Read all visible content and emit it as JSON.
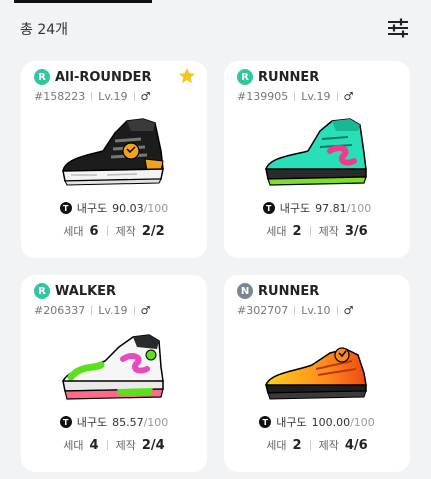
{
  "header": {
    "total_label": "총 24개"
  },
  "labels": {
    "durability": "내구도",
    "generation": "세대",
    "crafting": "제작"
  },
  "cards": [
    {
      "grade": "R",
      "grade_color": "#2fc7a0",
      "type": "All-ROUNDER",
      "id": "#158223",
      "level": "Lv.19",
      "gender": "♂",
      "favorite": true,
      "durability": "90.03",
      "durability_max": "/100",
      "generation": "6",
      "crafting": "2/2",
      "shoe_icon": "high-top-black-orange-sneaker-icon"
    },
    {
      "grade": "R",
      "grade_color": "#2fc7a0",
      "type": "RUNNER",
      "id": "#139905",
      "level": "Lv.19",
      "gender": "♂",
      "favorite": false,
      "durability": "97.81",
      "durability_max": "/100",
      "generation": "2",
      "crafting": "3/6",
      "shoe_icon": "high-top-teal-pink-sneaker-icon"
    },
    {
      "grade": "R",
      "grade_color": "#2fc7a0",
      "type": "WALKER",
      "id": "#206337",
      "level": "Lv.19",
      "gender": "♂",
      "favorite": false,
      "durability": "85.57",
      "durability_max": "/100",
      "generation": "4",
      "crafting": "2/4",
      "shoe_icon": "white-green-pink-sneaker-icon"
    },
    {
      "grade": "N",
      "grade_color": "#7c8593",
      "type": "RUNNER",
      "id": "#302707",
      "level": "Lv.10",
      "gender": "♂",
      "favorite": false,
      "durability": "100.00",
      "durability_max": "/100",
      "generation": "2",
      "crafting": "4/6",
      "shoe_icon": "orange-gradient-sneaker-icon"
    }
  ]
}
